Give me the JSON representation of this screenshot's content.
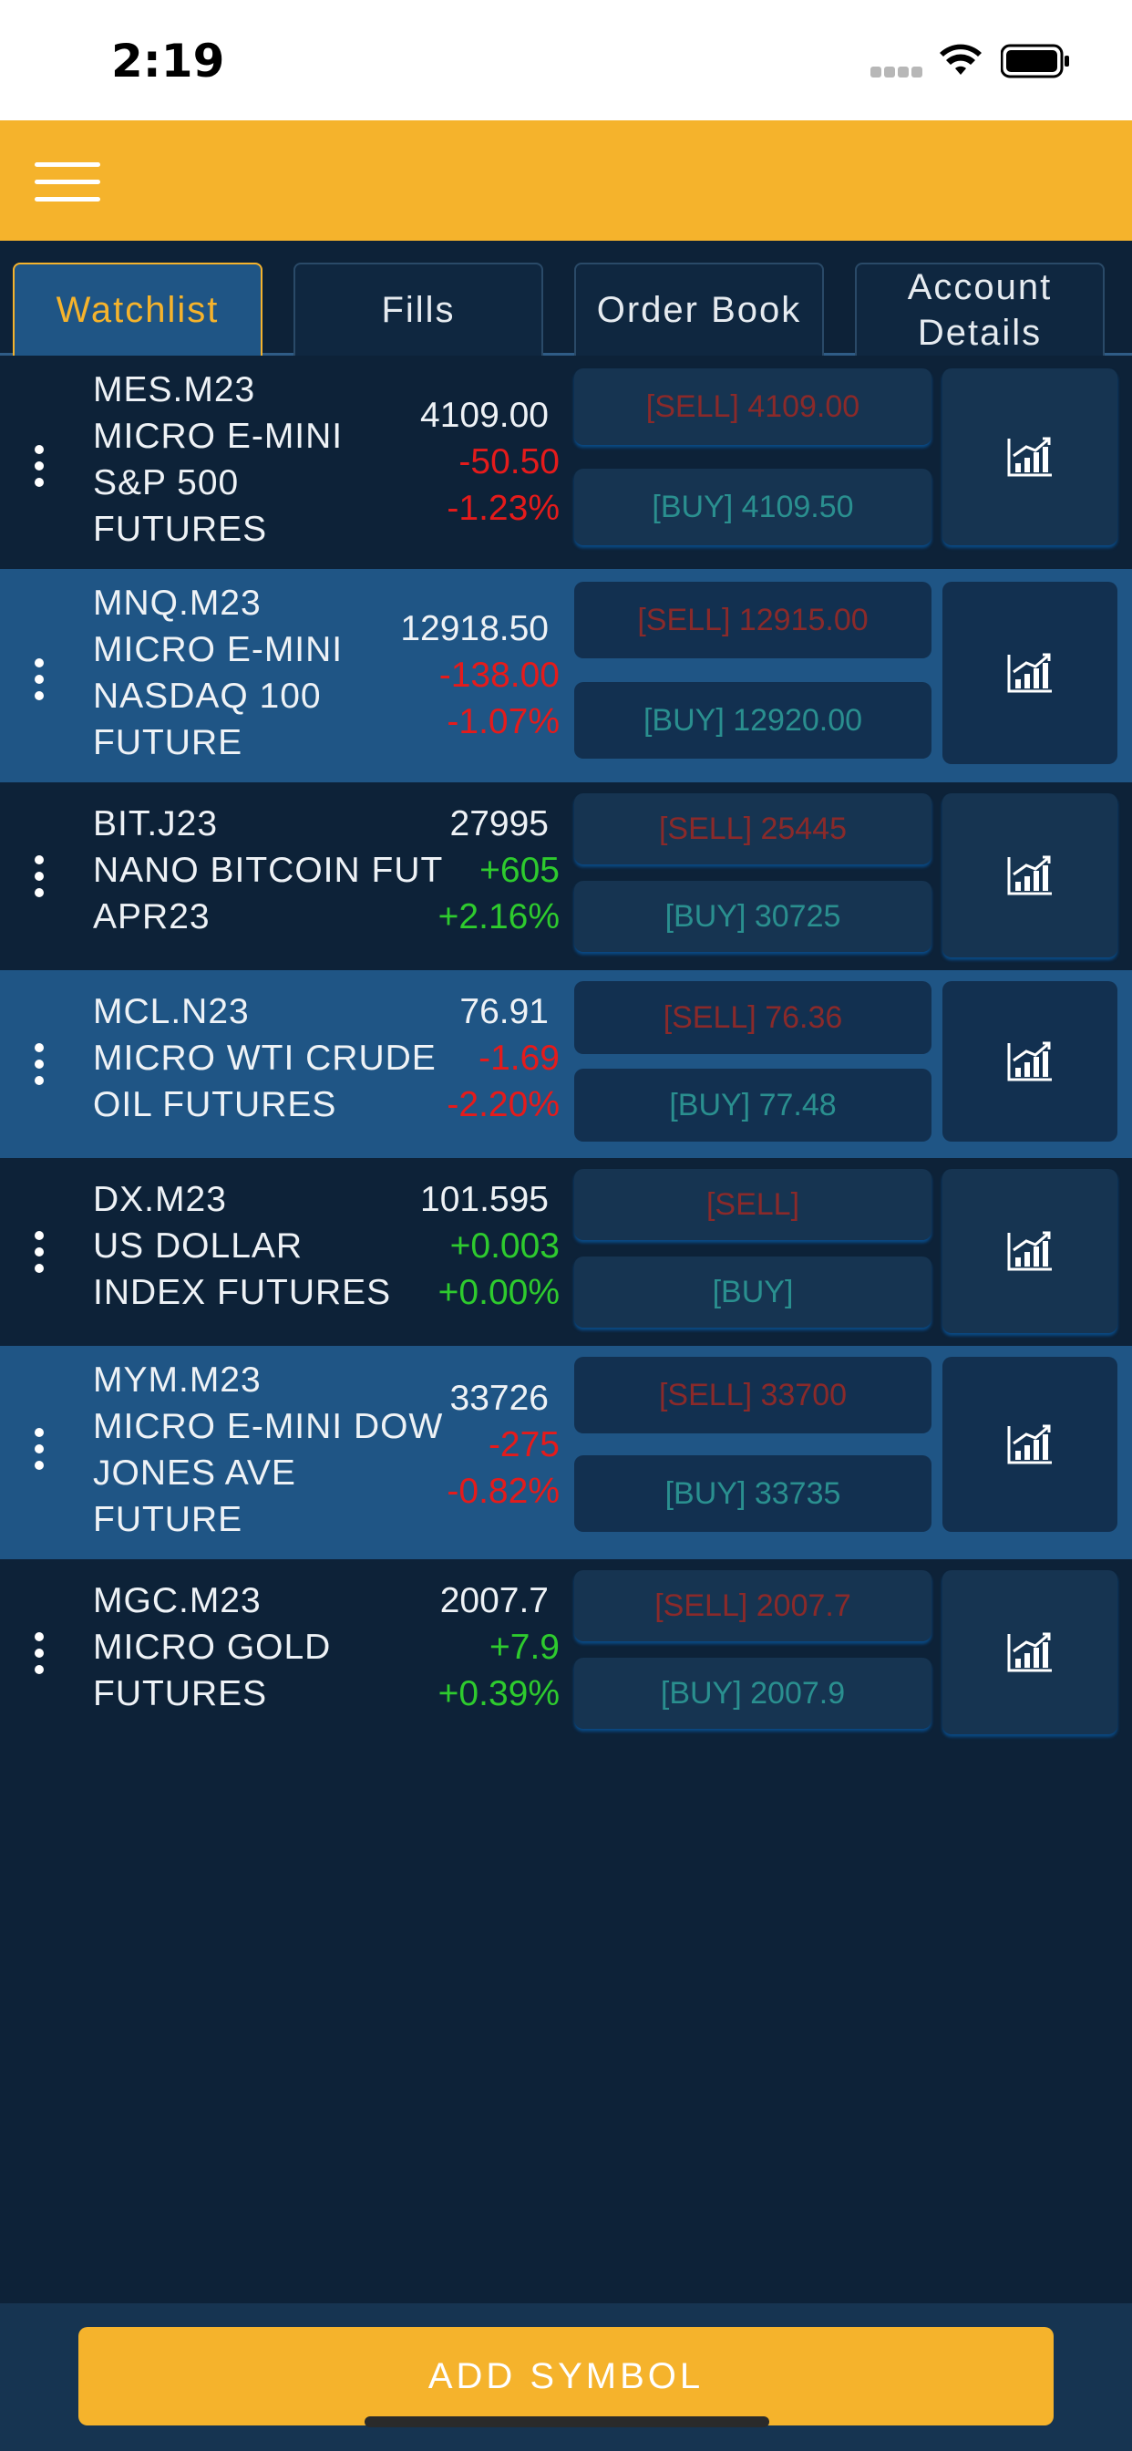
{
  "status_bar": {
    "time": "2:19"
  },
  "tabs": [
    {
      "label": "Watchlist",
      "active": true
    },
    {
      "label": "Fills",
      "active": false
    },
    {
      "label": "Order Book",
      "active": false
    },
    {
      "label": "Account\nDetails",
      "active": false
    }
  ],
  "rows": [
    {
      "symbol": "MES.M23",
      "name": "MICRO E-MINI\nS&P 500\nFUTURES",
      "last": "4109.00",
      "change": "-50.50",
      "change_pct": "-1.23%",
      "direction": "neg",
      "sell": "[SELL] 4109.00",
      "buy": "[BUY] 4109.50"
    },
    {
      "symbol": "MNQ.M23",
      "name": "MICRO E-MINI\nNASDAQ 100\nFUTURE",
      "last": "12918.50",
      "change": "-138.00",
      "change_pct": "-1.07%",
      "direction": "neg",
      "sell": "[SELL] 12915.00",
      "buy": "[BUY] 12920.00"
    },
    {
      "symbol": "BIT.J23",
      "name": "NANO BITCOIN FUT\nAPR23",
      "last": "27995",
      "change": "+605",
      "change_pct": "+2.16%",
      "direction": "pos",
      "sell": "[SELL] 25445",
      "buy": "[BUY] 30725"
    },
    {
      "symbol": "MCL.N23",
      "name": "MICRO WTI CRUDE\nOIL FUTURES",
      "last": "76.91",
      "change": "-1.69",
      "change_pct": "-2.20%",
      "direction": "neg",
      "sell": "[SELL] 76.36",
      "buy": "[BUY] 77.48"
    },
    {
      "symbol": "DX.M23",
      "name": "US DOLLAR\nINDEX FUTURES",
      "last": "101.595",
      "change": "+0.003",
      "change_pct": "+0.00%",
      "direction": "pos",
      "sell": "[SELL]",
      "buy": "[BUY]"
    },
    {
      "symbol": "MYM.M23",
      "name": "MICRO E-MINI DOW\nJONES AVE\nFUTURE",
      "last": "33726",
      "change": "-275",
      "change_pct": "-0.82%",
      "direction": "neg",
      "sell": "[SELL] 33700",
      "buy": "[BUY] 33735"
    },
    {
      "symbol": "MGC.M23",
      "name": "MICRO GOLD\nFUTURES",
      "last": "2007.7",
      "change": "+7.9",
      "change_pct": "+0.39%",
      "direction": "pos",
      "sell": "[SELL] 2007.7",
      "buy": "[BUY] 2007.9"
    }
  ],
  "footer": {
    "add_symbol_label": "ADD SYMBOL"
  },
  "colors": {
    "accent": "#f5b32c",
    "row_dark": "#0d2238",
    "row_light": "#1f5585",
    "negative": "#e51b1b",
    "positive": "#2ecb2e"
  }
}
